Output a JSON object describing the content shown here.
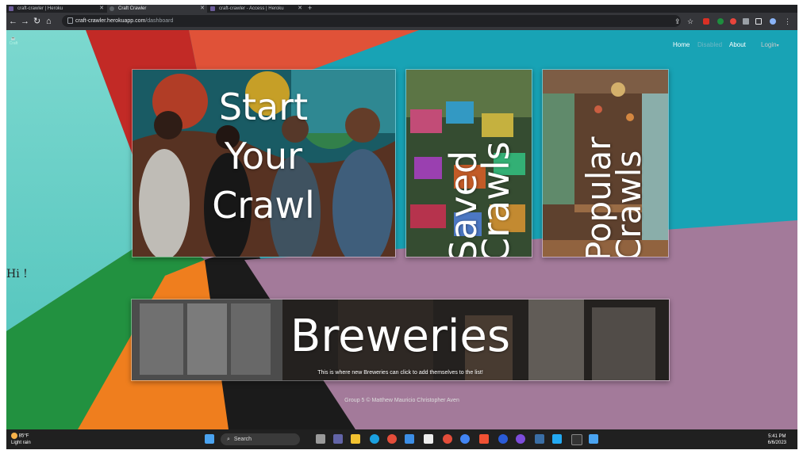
{
  "browser": {
    "tabs": [
      {
        "title": "craft-crawler | Heroku",
        "active": false
      },
      {
        "title": "Craft Crawler",
        "active": true
      },
      {
        "title": "craft-crawler - Access | Heroku",
        "active": false
      }
    ],
    "url_host": "craft-crawler.herokuapp.com",
    "url_path": "/dashboard"
  },
  "nav": {
    "home": "Home",
    "disabled": "Disabled",
    "about": "About",
    "login": "Login"
  },
  "greeting": "Hi !",
  "cards": {
    "start_crawl": {
      "line1": "Start",
      "line2": "Your",
      "line3": "Crawl"
    },
    "saved_crawls": {
      "line1": "Saved",
      "line2": "Crawls"
    },
    "popular_crawls": {
      "line1": "Popular",
      "line2": "Crawls"
    },
    "breweries": {
      "title": "Breweries",
      "caption": "This is where new Breweries can click to add themselves to the list!"
    }
  },
  "footer": "Group 5 © Matthew Mauricio Christopher Aven",
  "taskbar": {
    "search_placeholder": "Search",
    "weather_temp": "85°F",
    "weather_desc": "Light rain",
    "time": "5:41 PM",
    "date": "6/6/2023"
  },
  "colors": {
    "teal": "#18a3b5",
    "mauve": "#a37a9a",
    "red": "#e05238",
    "green": "#229140",
    "orange": "#ef7e1e",
    "mint": "#69d2c9"
  }
}
